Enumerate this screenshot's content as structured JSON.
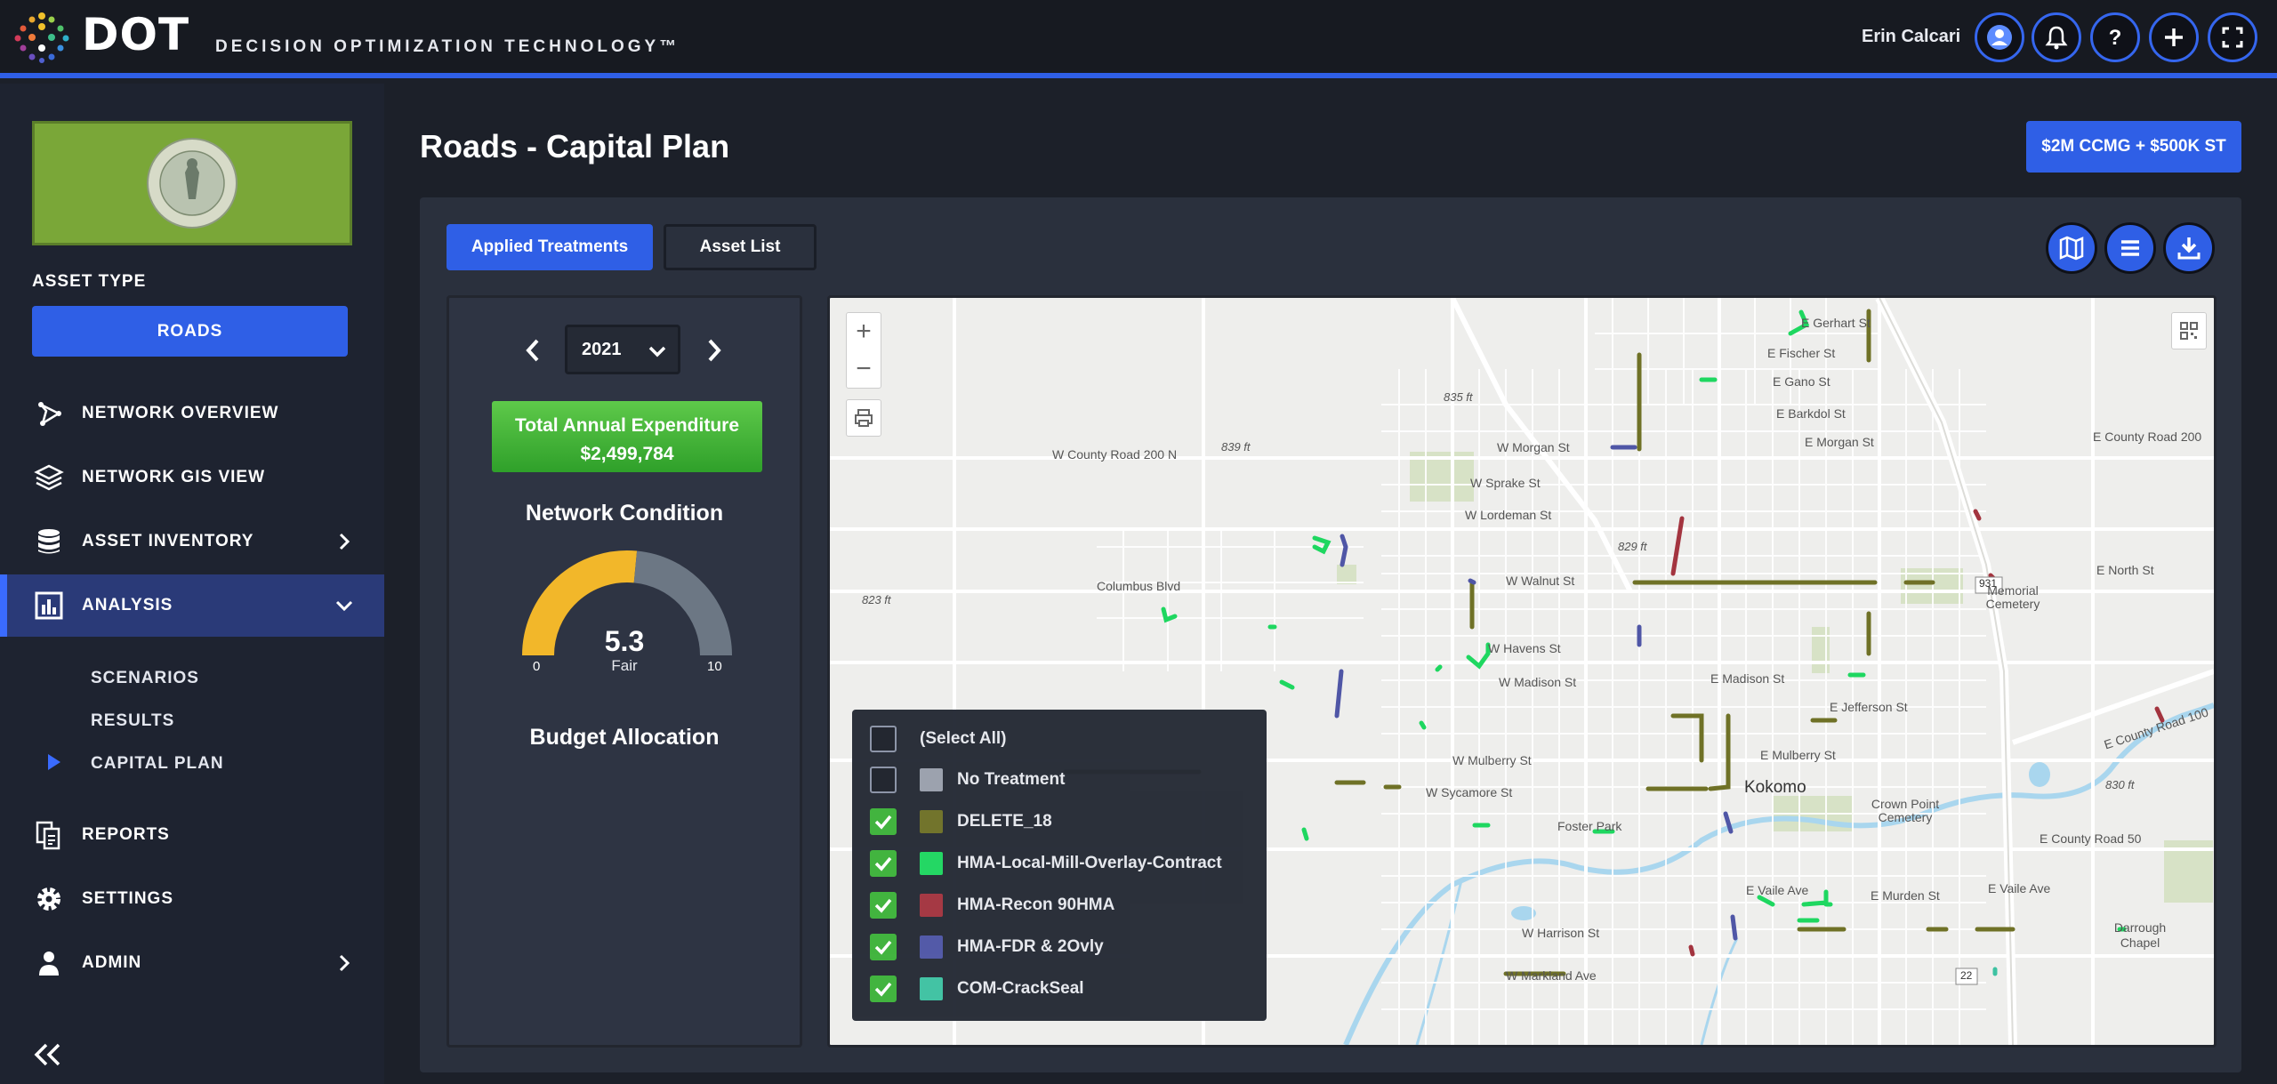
{
  "header": {
    "brand": "DOT",
    "tagline": "DECISION OPTIMIZATION TECHNOLOGY™",
    "user_name": "Erin Calcari",
    "icons": [
      "user-icon",
      "bell-icon",
      "help-icon",
      "plus-icon",
      "fullscreen-icon"
    ],
    "accent": "#2f5fe6"
  },
  "sidebar": {
    "asset_type_label": "ASSET TYPE",
    "asset_type_value": "ROADS",
    "items": [
      {
        "label": "NETWORK OVERVIEW",
        "icon": "network-icon"
      },
      {
        "label": "NETWORK GIS VIEW",
        "icon": "layers-icon"
      },
      {
        "label": "ASSET INVENTORY",
        "icon": "database-icon"
      },
      {
        "label": "ANALYSIS",
        "icon": "chart-icon"
      },
      {
        "label": "REPORTS",
        "icon": "reports-icon"
      },
      {
        "label": "SETTINGS",
        "icon": "gear-icon"
      },
      {
        "label": "ADMIN",
        "icon": "person-icon"
      }
    ],
    "analysis_sub": [
      "SCENARIOS",
      "RESULTS",
      "CAPITAL PLAN"
    ]
  },
  "main": {
    "title": "Roads - Capital Plan",
    "scenario_button": "$2M CCMG + $500K ST",
    "tabs": [
      "Applied Treatments",
      "Asset List"
    ],
    "year": "2021",
    "expenditure_title": "Total Annual Expenditure",
    "expenditure_value": "$2,499,784",
    "network_condition_title": "Network Condition",
    "gauge": {
      "value": "5.3",
      "label": "Fair",
      "min": "0",
      "max": "10",
      "fraction": 0.53
    },
    "budget_title": "Budget Allocation"
  },
  "legend": {
    "select_all": "(Select All)",
    "items": [
      {
        "label": "No Treatment",
        "color": "#9aa0ad",
        "checked": false
      },
      {
        "label": "DELETE_18",
        "color": "#6f7126",
        "checked": true
      },
      {
        "label": "HMA-Local-Mill-Overlay-Contract",
        "color": "#1ed760",
        "checked": true
      },
      {
        "label": "HMA-Recon 90HMA",
        "color": "#a3343f",
        "checked": true
      },
      {
        "label": "HMA-FDR & 2Ovly",
        "color": "#4f56a6",
        "checked": true
      },
      {
        "label": "COM-CrackSeal",
        "color": "#3ec2a2",
        "checked": true
      }
    ]
  },
  "map": {
    "labels": {
      "gerhart": "E Gerhart St",
      "fischer": "E Fischer St",
      "gano": "E Gano St",
      "barkdol": "E Barkdol St",
      "morgan_w": "W Morgan St",
      "morgan_e": "E Morgan St",
      "county200n": "W County Road 200 N",
      "county200e": "E County Road 200",
      "spraker": "W Sprake St",
      "lordeman": "W Lordeman St",
      "north": "E North St",
      "walnut": "W Walnut St",
      "columbus": "Columbus Blvd",
      "havens": "W Havens St",
      "madison_w": "W Madison St",
      "madison_e": "E Madison St",
      "jefferson": "E Jefferson St",
      "mulberry_w": "W Mulberry St",
      "mulberry_e": "E Mulberry St",
      "sycamore": "W Sycamore St",
      "kokomo": "Kokomo",
      "foster": "Foster Park",
      "crownpoint": "Crown Point Cemetery",
      "memorial": "Memorial Cemetery",
      "vaile": "E Vaile Ave",
      "murden": "E Murden St",
      "vaile2": "E Vaile Ave",
      "harrison": "W Harrison St",
      "markland": "W Markland Ave",
      "county50": "E County Road 50",
      "county100": "E County Road 100",
      "darrough": "Darrough Chapel",
      "e835": "835 ft",
      "e839": "839 ft",
      "e829": "829 ft",
      "e823": "823 ft",
      "e830": "830 ft",
      "r931": "931",
      "r22": "22"
    }
  }
}
